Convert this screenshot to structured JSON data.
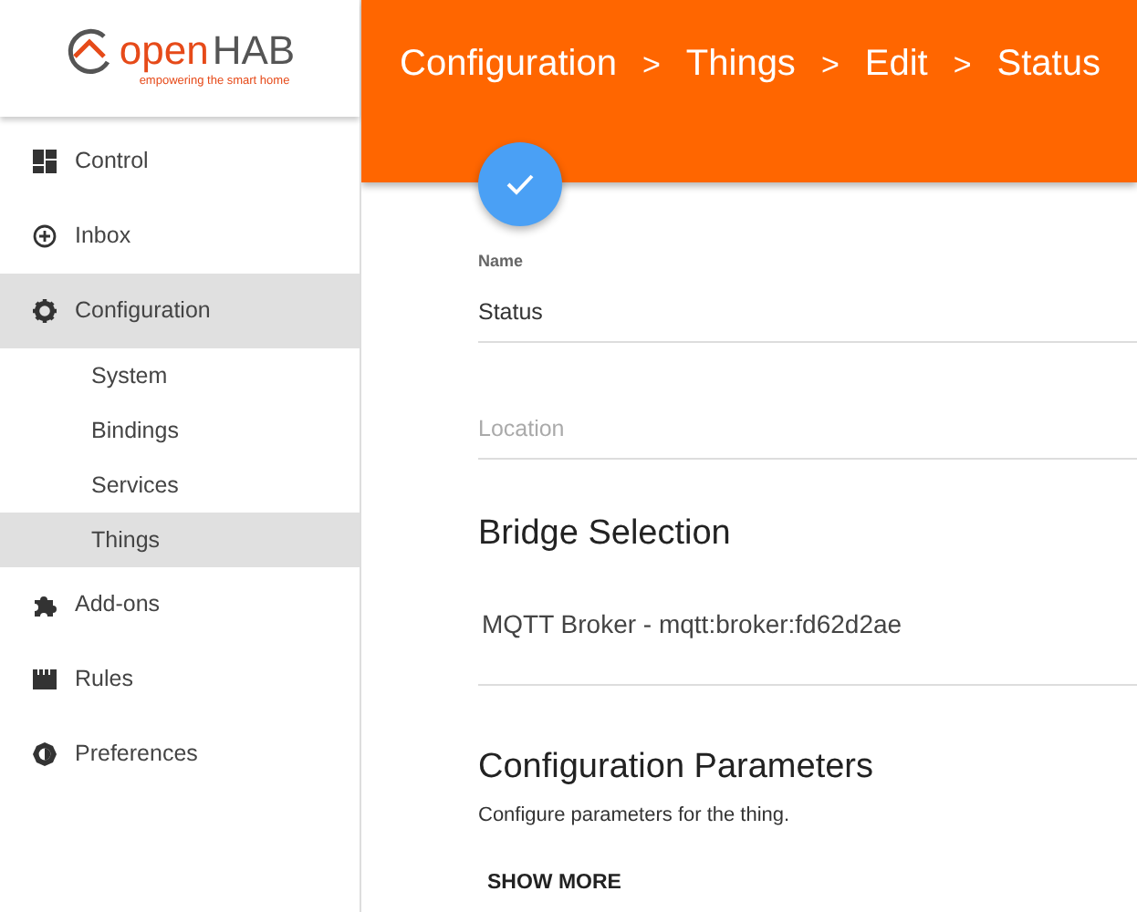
{
  "logo": {
    "text_1": "open",
    "text_2": "HAB",
    "tagline": "empowering the smart home"
  },
  "sidebar": {
    "items": [
      {
        "kind": "control",
        "label": "Control",
        "selected": false
      },
      {
        "kind": "inbox",
        "label": "Inbox",
        "selected": false
      },
      {
        "kind": "configuration",
        "label": "Configuration",
        "selected": true,
        "children": [
          {
            "label": "System",
            "selected": false
          },
          {
            "label": "Bindings",
            "selected": false
          },
          {
            "label": "Services",
            "selected": false
          },
          {
            "label": "Things",
            "selected": true
          }
        ]
      },
      {
        "kind": "addons",
        "label": "Add-ons",
        "selected": false
      },
      {
        "kind": "rules",
        "label": "Rules",
        "selected": false
      },
      {
        "kind": "preferences",
        "label": "Preferences",
        "selected": false
      }
    ]
  },
  "header": {
    "breadcrumb": [
      {
        "kind": "crumb",
        "text": "Configuration"
      },
      {
        "kind": "separator",
        "text": ">"
      },
      {
        "kind": "crumb",
        "text": "Things"
      },
      {
        "kind": "separator",
        "text": ">"
      },
      {
        "kind": "crumb",
        "text": "Edit"
      },
      {
        "kind": "separator",
        "text": ">"
      },
      {
        "kind": "crumb",
        "text": "Status"
      }
    ]
  },
  "form": {
    "name_label": "Name",
    "name_value": "Status",
    "location_placeholder": "Location",
    "bridge_heading": "Bridge Selection",
    "bridge_value": "MQTT Broker - mqtt:broker:fd62d2ae",
    "params_heading": "Configuration Parameters",
    "params_description": "Configure parameters for the thing.",
    "show_more": "SHOW MORE"
  }
}
